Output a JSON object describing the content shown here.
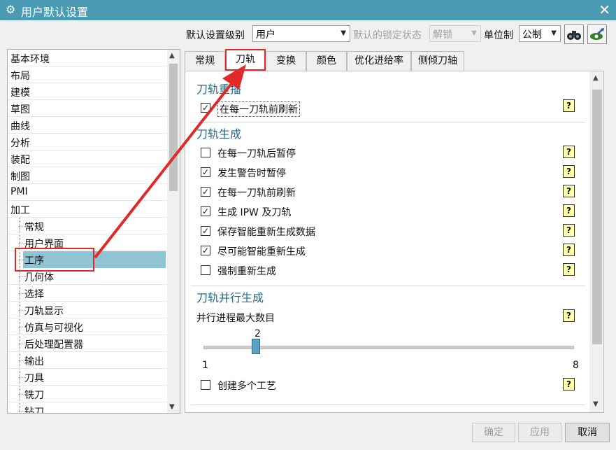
{
  "window": {
    "title": "用户默认设置",
    "close_glyph": "✕"
  },
  "toolbar": {
    "level_label": "默认设置级别",
    "level_value": "用户",
    "lock_label": "默认的锁定状态",
    "lock_value": "解锁",
    "unit_label": "单位制",
    "unit_value": "公制"
  },
  "tree": {
    "top_items": [
      "基本环境",
      "布局",
      "建模",
      "草图",
      "曲线",
      "分析",
      "装配",
      "制图",
      "PMI",
      "加工"
    ],
    "child_items": [
      "常规",
      "用户界面",
      "工序",
      "几何体",
      "选择",
      "刀轨显示",
      "仿真与可视化",
      "后处理配置器",
      "输出",
      "刀具",
      "铣刀",
      "钻刀"
    ],
    "selected": "工序"
  },
  "tabs": [
    "常规",
    "刀轨",
    "变换",
    "颜色",
    "优化进给率",
    "侧倾刀轴"
  ],
  "active_tab": "刀轨",
  "panel": {
    "group1": {
      "title": "刀轨重播",
      "options": [
        {
          "label": "在每一刀轨前刷新",
          "checked": true
        }
      ]
    },
    "group2": {
      "title": "刀轨生成",
      "options": [
        {
          "label": "在每一刀轨后暂停",
          "checked": false
        },
        {
          "label": "发生警告时暂停",
          "checked": true
        },
        {
          "label": "在每一刀轨前刷新",
          "checked": true
        },
        {
          "label": "生成 IPW 及刀轨",
          "checked": true
        },
        {
          "label": "保存智能重新生成数据",
          "checked": true
        },
        {
          "label": "尽可能智能重新生成",
          "checked": true
        },
        {
          "label": "强制重新生成",
          "checked": false
        }
      ]
    },
    "group3": {
      "title": "刀轨并行生成",
      "slider_label": "并行进程最大数目",
      "slider_value": "2",
      "slider_min": "1",
      "slider_max": "8",
      "option": {
        "label": "创建多个工艺",
        "checked": false
      }
    }
  },
  "help_glyph": "?",
  "check_glyph": "✓",
  "buttons": {
    "ok": "确定",
    "apply": "应用",
    "cancel": "取消"
  },
  "colors": {
    "accent": "#4a9bb3",
    "selection": "#8fc4d4",
    "highlight": "#e02a2a",
    "group_title": "#1d6a8a"
  }
}
